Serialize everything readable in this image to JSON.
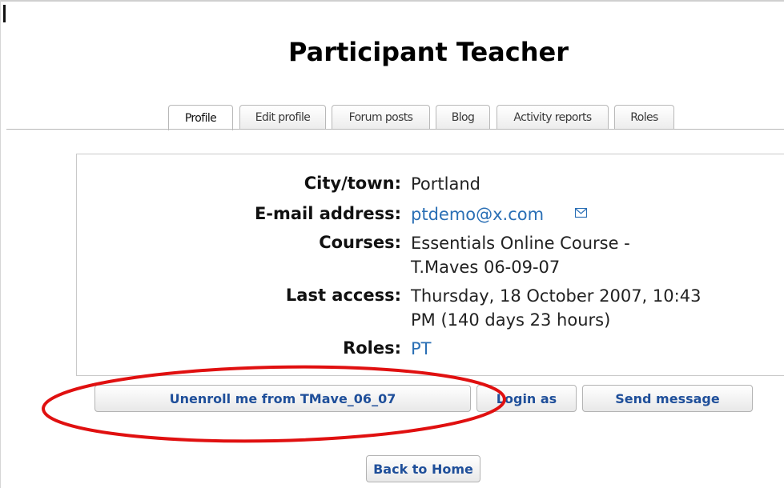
{
  "page_title": "Participant Teacher",
  "tabs": [
    {
      "label": "Profile",
      "active": true
    },
    {
      "label": "Edit profile",
      "active": false
    },
    {
      "label": "Forum posts",
      "active": false
    },
    {
      "label": "Blog",
      "active": false
    },
    {
      "label": "Activity reports",
      "active": false
    },
    {
      "label": "Roles",
      "active": false
    }
  ],
  "profile": {
    "city_label": "City/town:",
    "city_value": "Portland",
    "email_label": "E-mail address:",
    "email_value": "ptdemo@x.com",
    "courses_label": "Courses:",
    "courses_line1": "Essentials Online Course -",
    "courses_line2": "T.Maves 06-09-07",
    "last_access_label": "Last access:",
    "last_access_line1": "Thursday, 18 October 2007, 10:43",
    "last_access_line2": "PM  (140 days 23 hours)",
    "roles_label": "Roles:",
    "roles_value": "PT"
  },
  "buttons": {
    "unenroll": "Unenroll me from TMave_06_07",
    "login_as": "Login as",
    "send_message": "Send message",
    "back_home": "Back to Home"
  },
  "colors": {
    "link": "#2a6fb5",
    "button_text": "#1f4f9a",
    "annotation": "#e01010"
  },
  "icons": {
    "email": "mail-icon"
  }
}
